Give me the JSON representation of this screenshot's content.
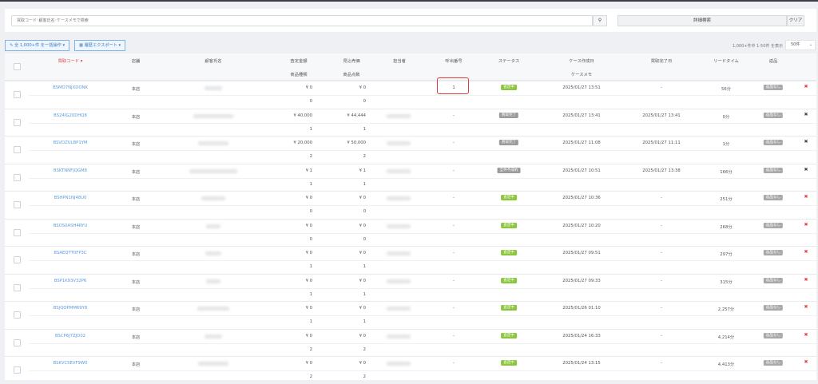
{
  "search": {
    "placeholder": "買取コード･顧客氏名･ケースメモで検索",
    "search_icon": "search-icon",
    "detail_label": "詳細検索",
    "clear_label": "クリア"
  },
  "toolbar": {
    "bulk_label": "全 1,000+件 を一括操作 ▾",
    "export_label": "履歴エクスポート ▾",
    "count_text": "1,000+件中 1-50件 を表示",
    "page_size": "50件"
  },
  "colors": {
    "link": "#5b9be0",
    "sort_active": "#e5413c",
    "status_green": "#8cc63f",
    "status_gray": "#9b9b9b",
    "highlight": "#e03a3a"
  },
  "headers": {
    "code": "買取コード",
    "store": "店舗",
    "customer": "顧客氏名",
    "appraisal": "査定金額",
    "item_types": "商品種類",
    "expected": "見込売価",
    "item_count": "商品点数",
    "staff": "担当者",
    "call_no": "呼出番号",
    "status": "ステータス",
    "created": "ケース作成日",
    "memo": "ケースメモ",
    "completed": "買取完了日",
    "lead": "リードタイム",
    "returns": "返品"
  },
  "rows": [
    {
      "code": "BSMO7NJXDONK",
      "store": "本店",
      "appraisal": "¥ 0",
      "expected": "¥ 0",
      "types": "0",
      "count": "0",
      "call": "1",
      "status": "査定中",
      "status_kind": "green",
      "created": "2025/01/27 13:51",
      "completed": "-",
      "lead": "56分",
      "ret": "返品なし",
      "del": "red"
    },
    {
      "code": "BS24IG20DHQ8",
      "store": "本店",
      "appraisal": "¥ 40,000",
      "expected": "¥ 44,444",
      "types": "1",
      "count": "1",
      "call": "-",
      "status": "買取完了",
      "status_kind": "gray",
      "created": "2025/01/27 13:41",
      "completed": "2025/01/27 13:41",
      "lead": "0分",
      "ret": "返品なし",
      "del": "gray"
    },
    {
      "code": "BSVDZULBP1YM",
      "store": "本店",
      "appraisal": "¥ 20,000",
      "expected": "¥ 50,000",
      "types": "2",
      "count": "2",
      "call": "-",
      "status": "買取完了",
      "status_kind": "gray",
      "created": "2025/01/27 11:08",
      "completed": "2025/01/27 11:11",
      "lead": "1分",
      "ret": "返品なし",
      "del": "gray"
    },
    {
      "code": "BSKTNNFJQGM8",
      "store": "本店",
      "appraisal": "¥ 1",
      "expected": "¥ 1",
      "types": "1",
      "count": "1",
      "call": "-",
      "status": "全件不成約",
      "status_kind": "gray",
      "created": "2025/01/27 10:51",
      "completed": "2025/01/27 13:38",
      "lead": "166分",
      "ret": "返品なし",
      "del": "gray"
    },
    {
      "code": "BSHPN1NJ48U0",
      "store": "本店",
      "appraisal": "¥ 0",
      "expected": "¥ 0",
      "types": "0",
      "count": "0",
      "call": "-",
      "status": "査定中",
      "status_kind": "green",
      "created": "2025/01/27 10:36",
      "completed": "-",
      "lead": "251分",
      "ret": "返品なし",
      "del": "red"
    },
    {
      "code": "BSOS0ASH4RYU",
      "store": "本店",
      "appraisal": "¥ 0",
      "expected": "¥ 0",
      "types": "0",
      "count": "0",
      "call": "-",
      "status": "査定中",
      "status_kind": "green",
      "created": "2025/01/27 10:20",
      "completed": "-",
      "lead": "268分",
      "ret": "返品なし",
      "del": "red"
    },
    {
      "code": "BSAEQTT0FP3C",
      "store": "本店",
      "appraisal": "¥ 0",
      "expected": "¥ 0",
      "types": "1",
      "count": "1",
      "call": "-",
      "status": "査定中",
      "status_kind": "green",
      "created": "2025/01/27 09:51",
      "completed": "-",
      "lead": "297分",
      "ret": "返品なし",
      "del": "red"
    },
    {
      "code": "BSP1K93V32P6",
      "store": "本店",
      "appraisal": "¥ 0",
      "expected": "¥ 0",
      "types": "1",
      "count": "1",
      "call": "-",
      "status": "査定中",
      "status_kind": "green",
      "created": "2025/01/27 09:33",
      "completed": "-",
      "lead": "315分",
      "ret": "返品なし",
      "del": "red"
    },
    {
      "code": "BSJQOPMM69Y8",
      "store": "本店",
      "appraisal": "¥ 0",
      "expected": "¥ 0",
      "types": "1",
      "count": "1",
      "call": "-",
      "status": "査定中",
      "status_kind": "green",
      "created": "2025/01/26 01:10",
      "completed": "-",
      "lead": "2,257分",
      "ret": "返品なし",
      "del": "red"
    },
    {
      "code": "BSCP6J7ZJD02",
      "store": "本店",
      "appraisal": "¥ 0",
      "expected": "¥ 0",
      "types": "2",
      "count": "2",
      "call": "-",
      "status": "査定中",
      "status_kind": "green",
      "created": "2025/01/24 16:33",
      "completed": "-",
      "lead": "4,214分",
      "ret": "返品なし",
      "del": "red"
    },
    {
      "code": "BSKVC5EVF9W0",
      "store": "本店",
      "appraisal": "¥ 0",
      "expected": "¥ 0",
      "types": "2",
      "count": "2",
      "call": "-",
      "status": "査定中",
      "status_kind": "green",
      "created": "2025/01/24 13:15",
      "completed": "-",
      "lead": "4,413分",
      "ret": "返品なし",
      "del": "red"
    }
  ]
}
